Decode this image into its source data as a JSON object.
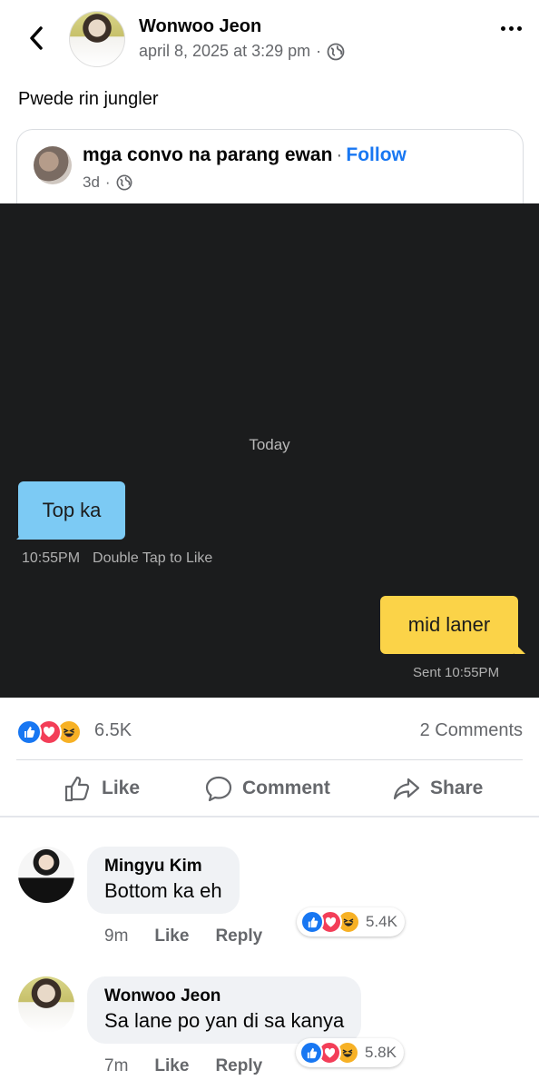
{
  "header": {
    "author": "Wonwoo Jeon",
    "timestamp": "april 8, 2025 at 3:29 pm",
    "separator": "·",
    "privacy_icon": "globe-icon",
    "back_icon": "chevron-left-icon",
    "more_icon": "more-horizontal-icon"
  },
  "post": {
    "text": "Pwede rin jungler"
  },
  "shared": {
    "page_name": "mga convo na parang ewan",
    "separator": "·",
    "follow_label": "Follow",
    "age": "3d",
    "meta_separator": "·"
  },
  "chat": {
    "day_label": "Today",
    "received_text": "Top ka",
    "received_time": "10:55PM",
    "received_hint": "Double Tap to Like",
    "sent_text": "mid laner",
    "sent_status": "Sent  10:55PM",
    "received_color": "#7ccaf4",
    "sent_color": "#fbd348"
  },
  "stats": {
    "reaction_count": "6.5K",
    "comments_count": "2 Comments"
  },
  "actions": {
    "like": "Like",
    "comment": "Comment",
    "share": "Share"
  },
  "comments": [
    {
      "author": "Mingyu Kim",
      "text": "Bottom ka eh",
      "time": "9m",
      "like": "Like",
      "reply": "Reply",
      "reactions": "5.4K"
    },
    {
      "author": "Wonwoo Jeon",
      "text": "Sa lane po yan di sa kanya",
      "time": "7m",
      "like": "Like",
      "reply": "Reply",
      "reactions": "5.8K"
    }
  ],
  "colors": {
    "accent": "#1877f2",
    "like": "#1877f2",
    "love": "#f33e58",
    "haha": "#f7b125",
    "muted_text": "#65676b"
  }
}
